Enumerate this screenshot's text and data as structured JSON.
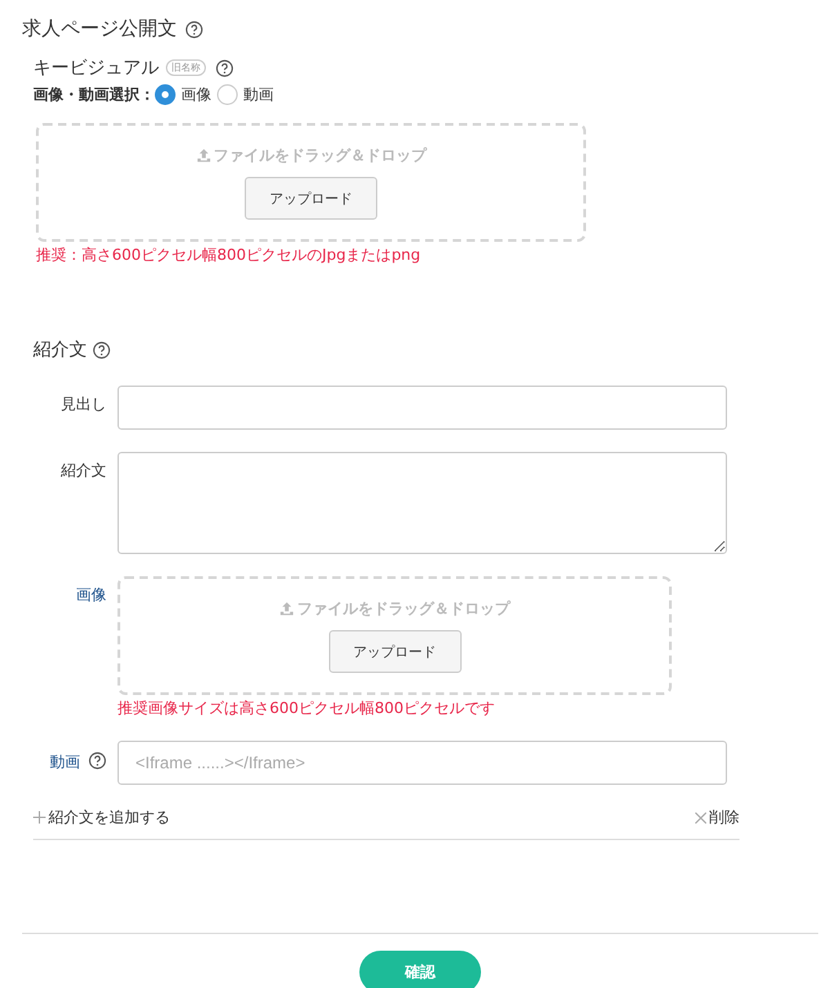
{
  "section_title": "求人ページ公開文",
  "key_visual": {
    "label": "キービジュアル",
    "badge": "旧名称",
    "media_label": "画像・動画選択：",
    "media_options": [
      {
        "label": "画像",
        "selected": true
      },
      {
        "label": "動画",
        "selected": false
      }
    ],
    "dropzone": {
      "prompt": "ファイルをドラッグ＆ドロップ",
      "button": "アップロード"
    },
    "note": "推奨：高さ600ピクセル幅800ピクセルのJpgまたはpng"
  },
  "intro": {
    "title": "紹介文",
    "fields": [
      {
        "kind": "input",
        "label": "見出し",
        "help": false
      },
      {
        "kind": "textarea",
        "label": "紹介文",
        "help": false
      },
      {
        "kind": "dropzone",
        "label": "画像",
        "help": false,
        "prompt": "ファイルをドラッグ＆ドロップ",
        "button": "アップロード",
        "note": "推奨画像サイズは高さ600ピクセル幅800ピクセルです"
      },
      {
        "kind": "input",
        "label": "動画",
        "help": true,
        "placeholder": "<Iframe ......></Iframe>"
      }
    ],
    "add_link": "紹介文を追加する",
    "delete_link": "削除"
  },
  "confirm_button": "確認"
}
